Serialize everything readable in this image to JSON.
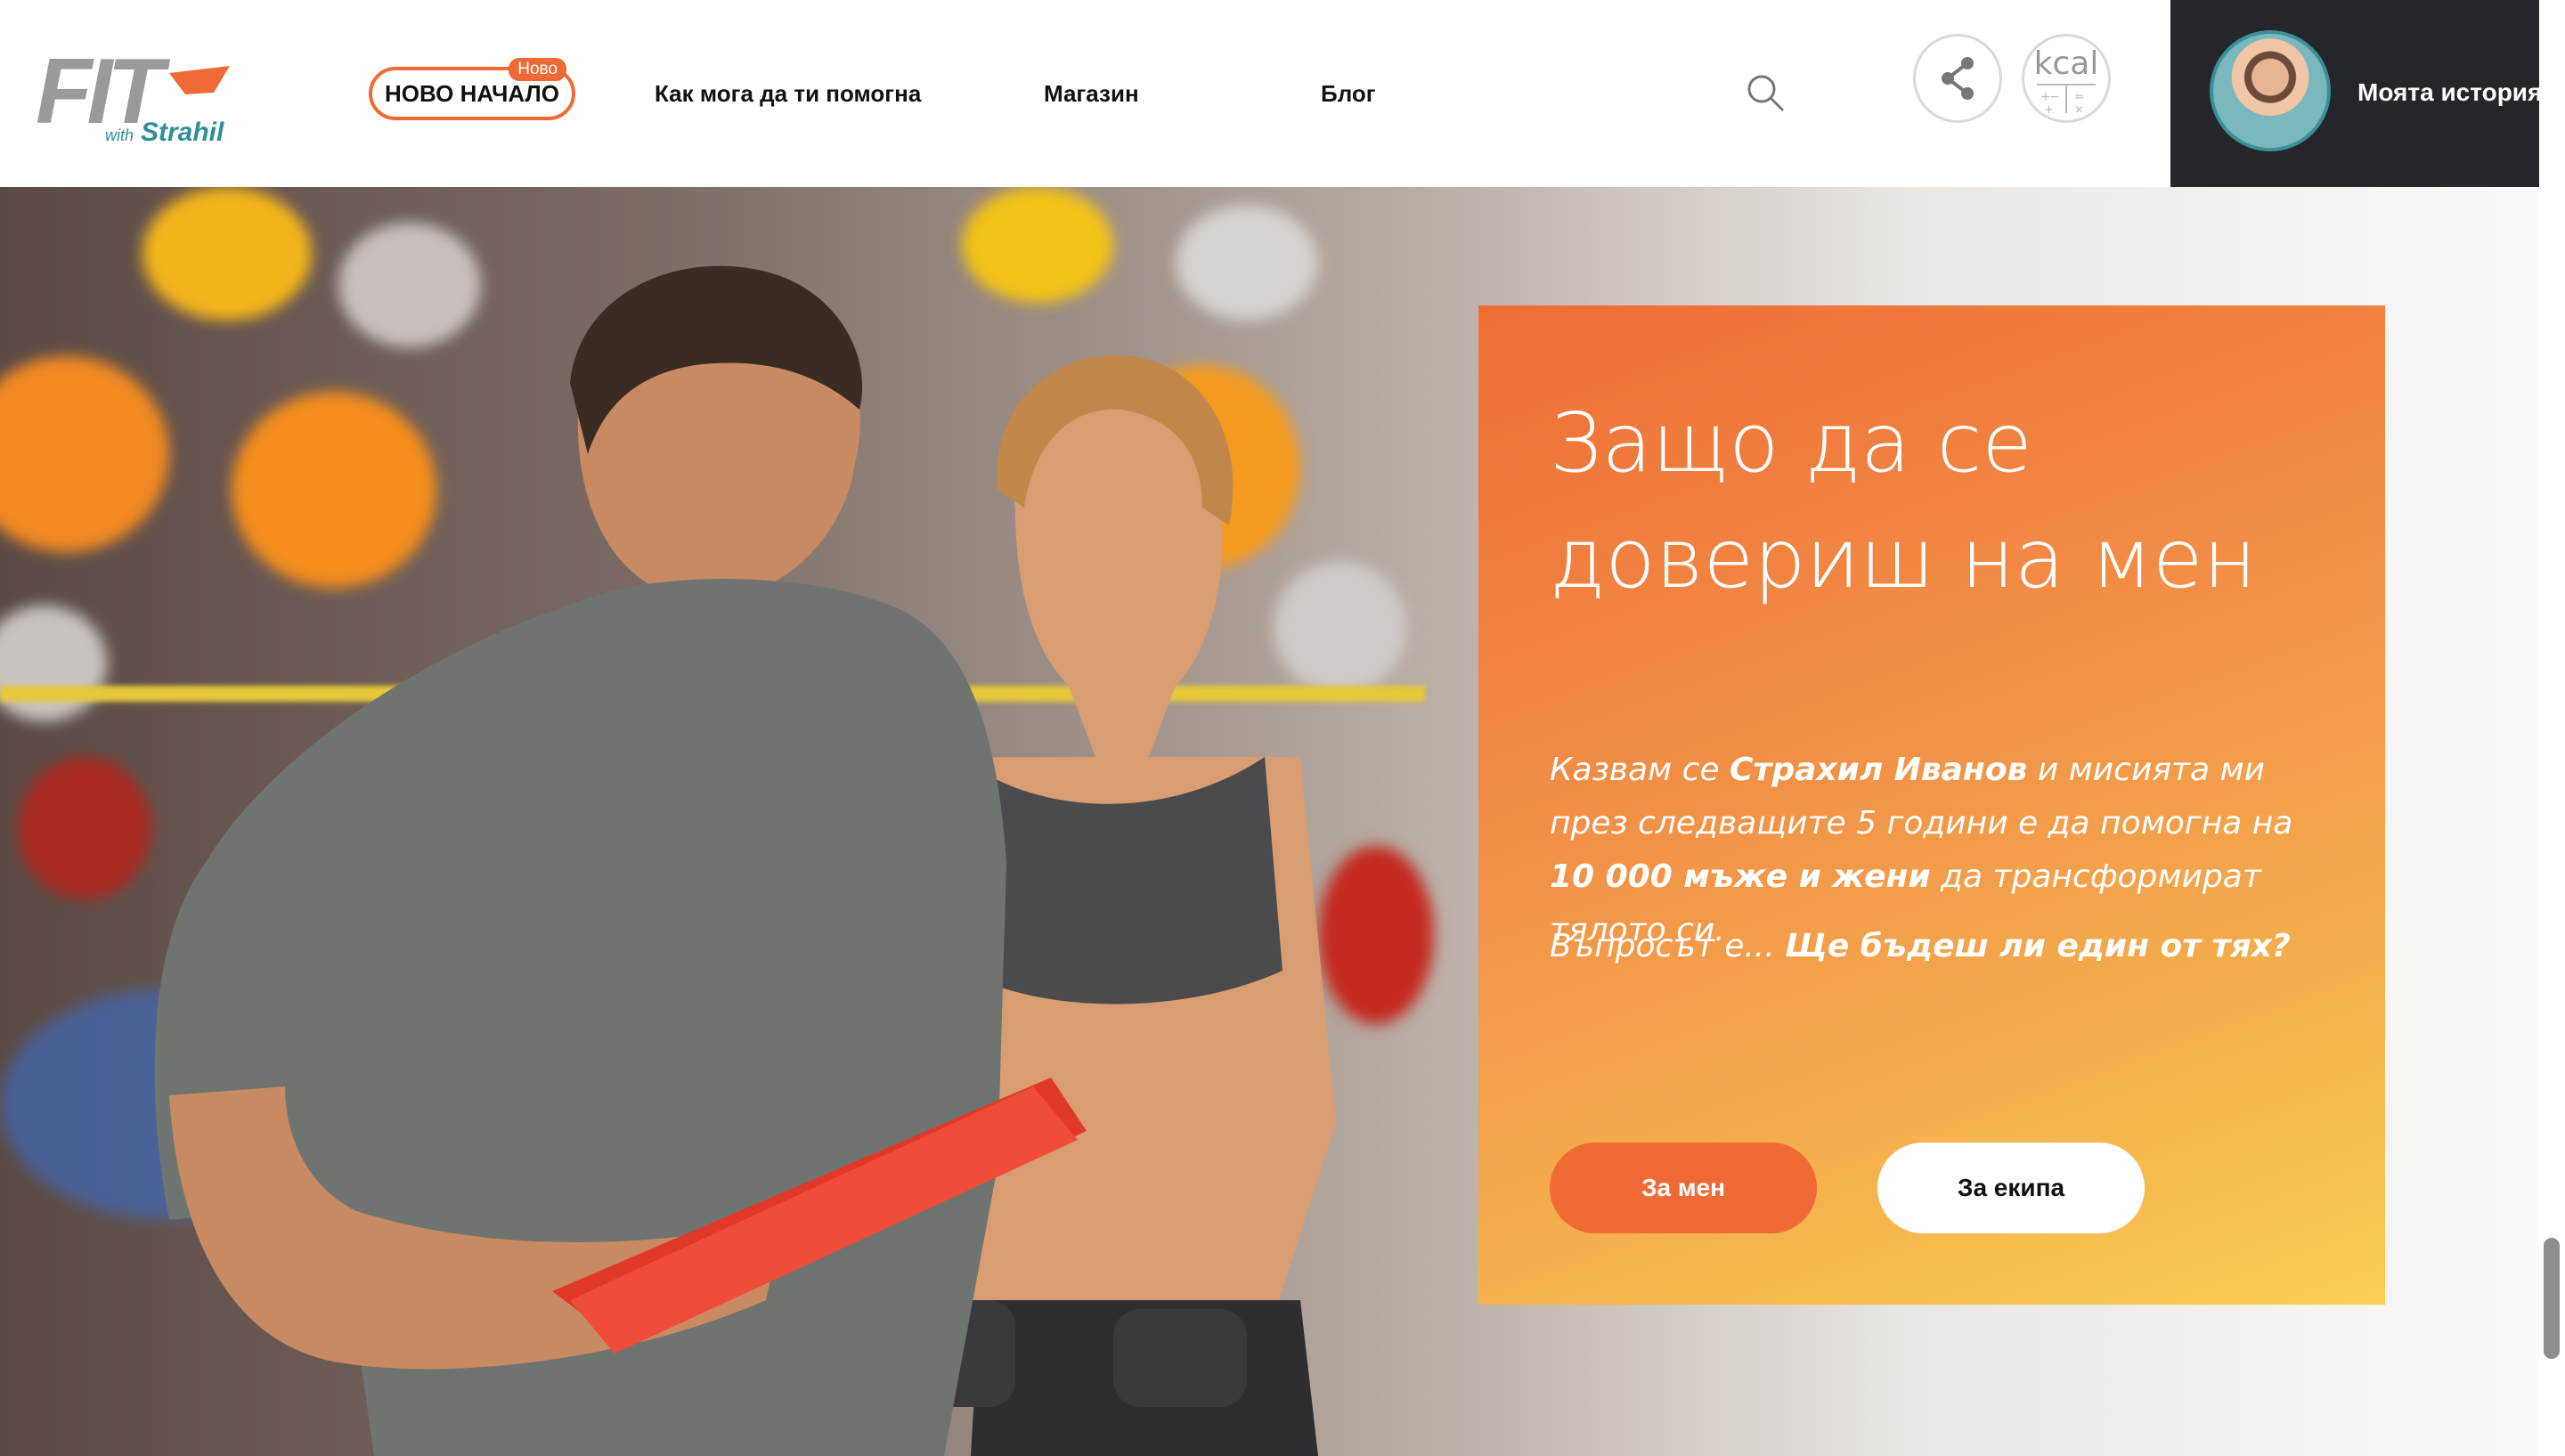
{
  "header": {
    "logo": {
      "main": "FIT",
      "sub_prefix": "with",
      "sub_name": "Strahil"
    },
    "nav": {
      "new_start": {
        "label": "НОВО НАЧАЛО",
        "badge": "Ново"
      },
      "help": "Как мога да ти помогна",
      "shop": "Магазин",
      "blog": "Блог"
    },
    "kcal_label": "kcal",
    "story_label": "Моята история"
  },
  "hero": {
    "title_line1": "Защо да се",
    "title_line2": "довериш на мен",
    "intro_1": "Казвам се ",
    "intro_name": "Страхил Иванов",
    "intro_2": " и мисията ми през следващите 5 години е да помогна на ",
    "intro_goal": "10 000 мъже и жени",
    "intro_3": " да трансформират тялото си.",
    "question_1": "Въпросът е... ",
    "question_2": "Ще бъдеш ли един от тях?",
    "button_me": "За мен",
    "button_team": "За екипа"
  },
  "colors": {
    "accent": "#ef6a35",
    "logo_gray": "#9a9a9a",
    "logo_teal": "#2f8f98",
    "story_bg": "#24262b"
  },
  "icons": [
    "search-icon",
    "share-icon",
    "calculator-icon"
  ]
}
